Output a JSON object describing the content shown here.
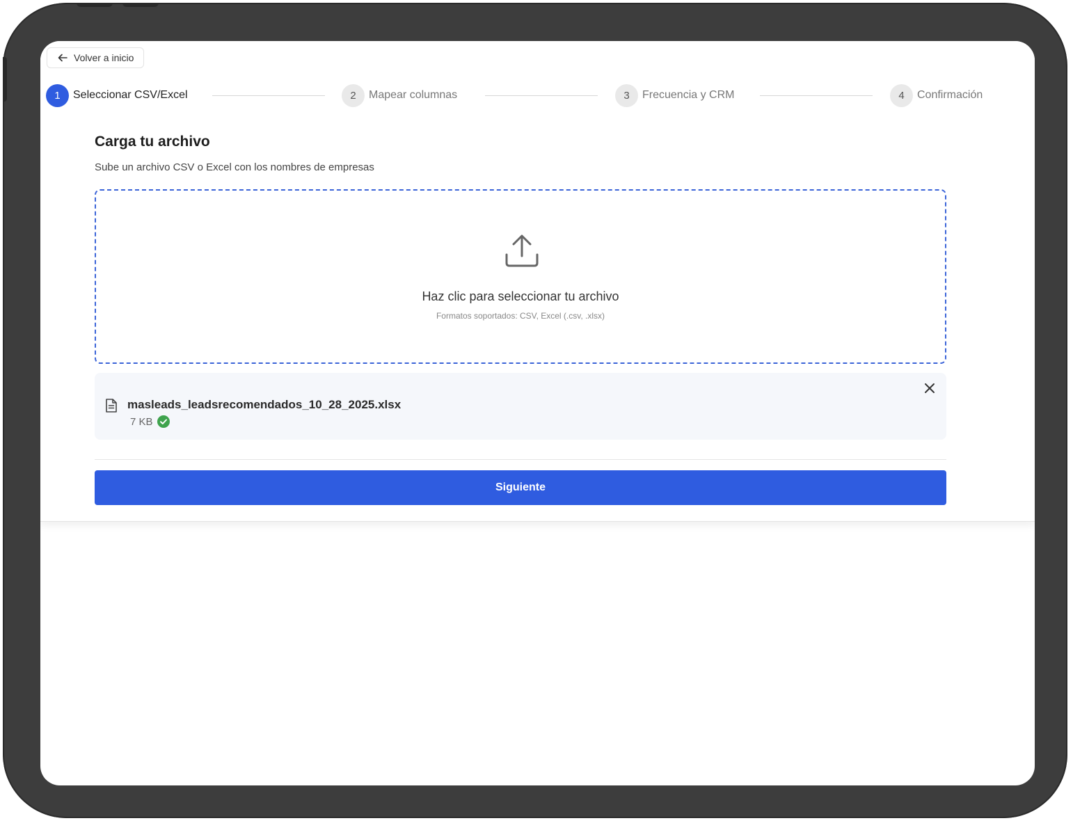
{
  "back_button": {
    "label": "Volver a inicio",
    "icon": "arrow-left-icon"
  },
  "stepper": {
    "steps": [
      {
        "number": "1",
        "label": "Seleccionar CSV/Excel",
        "active": true
      },
      {
        "number": "2",
        "label": "Mapear columnas",
        "active": false
      },
      {
        "number": "3",
        "label": "Frecuencia y CRM",
        "active": false
      },
      {
        "number": "4",
        "label": "Confirmación",
        "active": false
      }
    ]
  },
  "upload": {
    "title": "Carga tu archivo",
    "subtitle": "Sube un archivo CSV o Excel con los nombres de empresas",
    "dropzone_title": "Haz clic para seleccionar tu archivo",
    "dropzone_formats": "Formatos soportados: CSV, Excel (.csv, .xlsx)",
    "icon": "upload-icon"
  },
  "file": {
    "name": "masleads_leadsrecomendados_10_28_2025.xlsx",
    "size": "7 KB",
    "status_icon": "check-circle-icon",
    "remove_icon": "close-icon"
  },
  "actions": {
    "next_label": "Siguiente"
  },
  "colors": {
    "accent": "#2f5ce0",
    "success": "#3fa34d",
    "device_frame": "#3d3d3d"
  }
}
